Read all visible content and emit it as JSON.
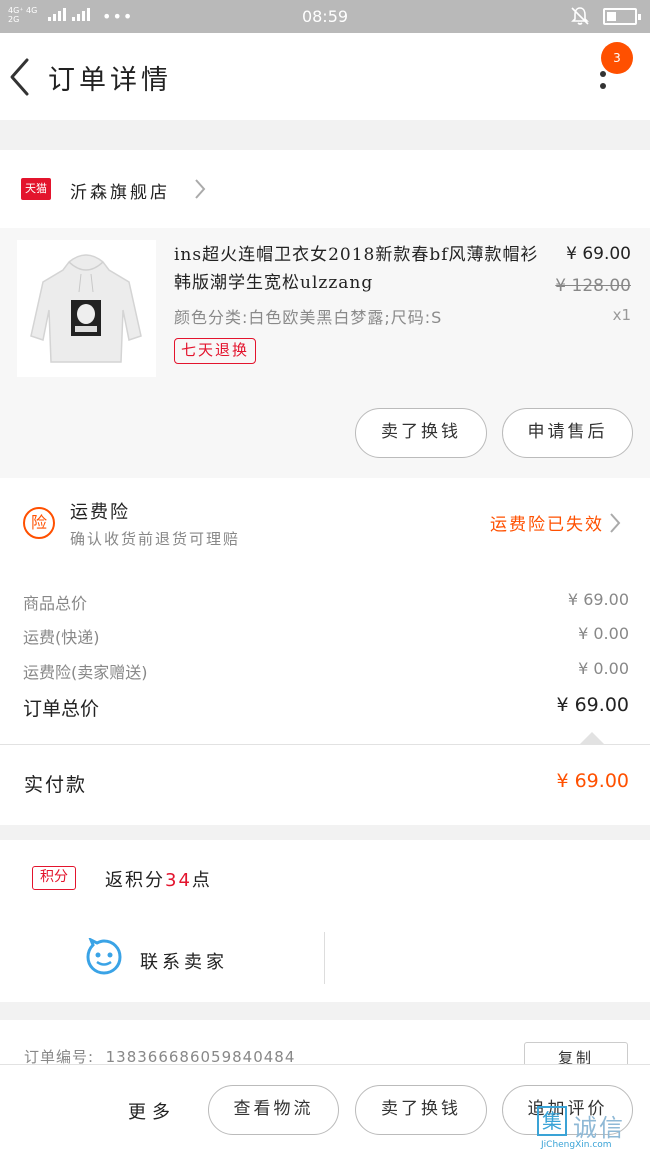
{
  "statusbar": {
    "network": "4G⁺ 4G  2G\n⁴⁵ 2G",
    "time": "08:59",
    "dots": "•••"
  },
  "header": {
    "title": "订单详情",
    "badge": "3"
  },
  "shop": {
    "platform_tag": "天猫",
    "name": "沂森旗舰店"
  },
  "product": {
    "title": "ins超火连帽卫衣女2018新款春bf风薄款帽衫韩版潮学生宽松ulzzang",
    "sku": "颜色分类:白色欧美黑白梦露;尺码:S",
    "service_tag": "七天退换",
    "price": "¥ 69.00",
    "original_price": "¥ 128.00",
    "quantity": "x1",
    "buttons": [
      "卖了换钱",
      "申请售后"
    ]
  },
  "insurance": {
    "icon_char": "险",
    "title": "运费险",
    "subtitle": "确认收货前退货可理赔",
    "status": "运费险已失效"
  },
  "fees": [
    {
      "label": "商品总价",
      "value": "¥ 69.00"
    },
    {
      "label": "运费(快递)",
      "value": "¥ 0.00"
    },
    {
      "label": "运费险(卖家赠送)",
      "value": "¥ 0.00"
    },
    {
      "label": "订单总价",
      "value": "¥ 69.00"
    }
  ],
  "payment": {
    "label": "实付款",
    "value": "¥ 69.00"
  },
  "points": {
    "tag": "积分",
    "prefix": "返积分",
    "count": "34",
    "suffix": "点"
  },
  "contact": {
    "label": "联系卖家"
  },
  "order": {
    "number_label": "订单编号:",
    "number_value": "138366686059840484",
    "copy_label": "复制"
  },
  "bottombar": {
    "more_label": "更多",
    "buttons": [
      "查看物流",
      "卖了换钱",
      "追加评价"
    ]
  },
  "watermark": {
    "box_char": "集",
    "cn": "诚信",
    "en": "JiChengXin.com"
  },
  "colors": {
    "accent": "#ff5000",
    "tmall_red": "#e3142d",
    "contact_blue": "#3aa3e6"
  }
}
